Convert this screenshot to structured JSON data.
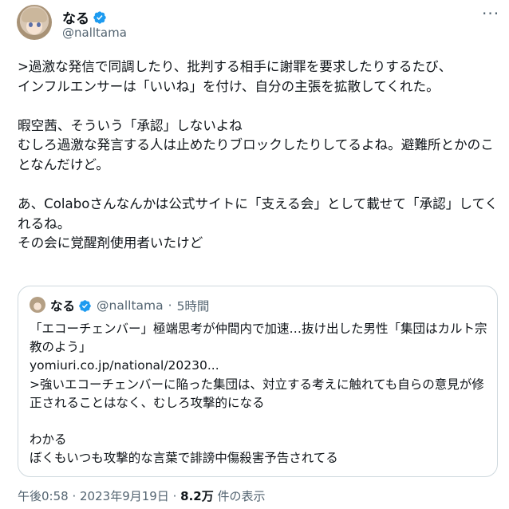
{
  "author": {
    "name": "なる",
    "handle": "@nalltama"
  },
  "post": {
    "text": ">過激な発信で同調したり、批判する相手に謝罪を要求したりするたび、\nインフルエンサーは「いいね」を付け、自分の主張を拡散してくれた。\n\n暇空茜、そういう「承認」しないよね\nむしろ過激な発言する人は止めたりブロックしたりしてるよね。避難所とかのことなんだけど。\n\nあ、Colaboさんなんかは公式サイトに「支える会」として載せて「承認」してくれるね。\nその会に覚醒剤使用者いたけど"
  },
  "quote": {
    "name": "なる",
    "handle": "@nalltama",
    "time": "5時間",
    "text": "「エコーチェンバー」極端思考が仲間内で加速…抜け出した男性「集団はカルト宗教のよう」\nyomiuri.co.jp/national/20230...\n>強いエコーチェンバーに陥った集団は、対立する考えに触れても自らの意見が修正されることはなく、むしろ攻撃的になる\n\nわかる\nぼくもいつも攻撃的な言葉で誹謗中傷殺害予告されてる"
  },
  "footer": {
    "time": "午後0:58",
    "date": "2023年9月19日",
    "views_count": "8.2万",
    "views_label": "件の表示"
  },
  "icons": {
    "verified": "verified-badge-icon",
    "more": "more-options-icon"
  },
  "colors": {
    "accent": "#1d9bf0",
    "text": "#0f1419",
    "secondary": "#536471",
    "border": "#cfd9de"
  }
}
